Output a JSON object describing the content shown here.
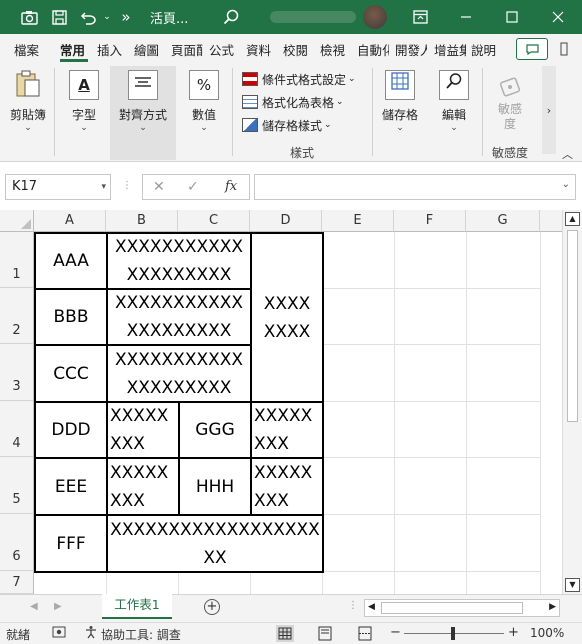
{
  "titlebar": {
    "filename": "活頁...",
    "user_name": "",
    "qat_more": "»"
  },
  "ribbon_tabs": [
    "檔案",
    "常用",
    "插入",
    "繪圖",
    "頁面配",
    "公式",
    "資料",
    "校閱",
    "檢視",
    "自動化",
    "開發人",
    "增益集",
    "說明"
  ],
  "active_tab": "常用",
  "ribbon": {
    "clipboard": "剪貼簿",
    "font": "字型",
    "alignment": "對齊方式",
    "number": "數值",
    "conditional_format": "條件式格式設定",
    "format_as_table": "格式化為表格",
    "cell_styles": "儲存格樣式",
    "styles_group": "樣式",
    "cells": "儲存格",
    "editing": "編輯",
    "sensitivity": "敏感度",
    "sensitivity_group": "敏感度",
    "number_icon": "%"
  },
  "formula_bar": {
    "name_box": "K17",
    "fx": "fx",
    "value": ""
  },
  "grid": {
    "columns": [
      "A",
      "B",
      "C",
      "D",
      "E",
      "F",
      "G"
    ],
    "rows": [
      "1",
      "2",
      "3",
      "4",
      "5",
      "6",
      "7"
    ],
    "cells": {
      "A1": "AAA",
      "B1": "XXXXXXXXXXXXXXXXXXXX",
      "D1": "XXXXXXXX",
      "A2": "BBB",
      "B2": "XXXXXXXXXXXXXXXXXXXX",
      "A3": "CCC",
      "B3": "XXXXXXXXXXXXXXXXXXXX",
      "A4": "DDD",
      "B4": "XXXXXXXX",
      "C4": "GGG",
      "D4": "XXXXXXXX",
      "A5": "EEE",
      "B5": "XXXXXXXX",
      "C5": "HHH",
      "D5": "XXXXXXXX",
      "A6": "FFF",
      "B6": "XXXXXXXXXXXXXXXXXXXX"
    }
  },
  "sheet_tabs": [
    "工作表1"
  ],
  "status": {
    "ready": "就緒",
    "accessibility": "協助工具: 調查",
    "zoom": "100%",
    "minus": "−",
    "plus": "+"
  },
  "colors": {
    "excel_green": "#217346",
    "ribbon_bg": "#f3f3f3"
  }
}
